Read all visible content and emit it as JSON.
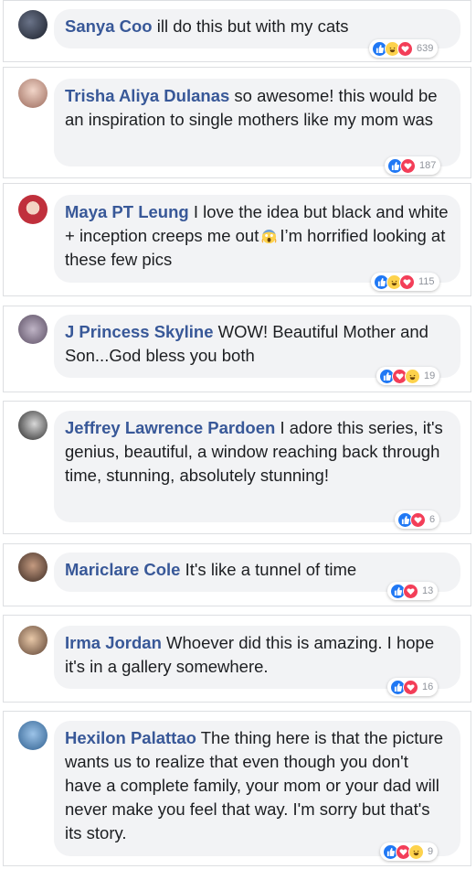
{
  "comments": [
    {
      "author": "Sanya Coo",
      "text": "ill do this but with my cats",
      "reactions": [
        "like",
        "haha",
        "love"
      ],
      "count": "639",
      "avatar_color": "#2a2f3a"
    },
    {
      "author": "Trisha Aliya Dulanas",
      "text": "so awesome! this would be an inspiration to single mothers like my mom was",
      "reactions": [
        "like",
        "love"
      ],
      "count": "187",
      "avatar_color": "#d8b7a8"
    },
    {
      "author": "Maya PT Leung",
      "text": "I love the idea but black and white + inception creeps me out",
      "text2": "I’m horrified looking at these few pics",
      "reactions": [
        "like",
        "haha",
        "love"
      ],
      "count": "115",
      "avatar_color": "#b33a45",
      "emoji": "screaming-face-icon"
    },
    {
      "author": "J Princess Skyline",
      "text": "WOW! Beautiful Mother and Son...God bless you both",
      "reactions": [
        "like",
        "love",
        "haha"
      ],
      "count": "19",
      "avatar_color": "#7a6a7f"
    },
    {
      "author": "Jeffrey Lawrence Pardoen",
      "text": "I adore this series, it's genius, beautiful, a window reaching back through time, stunning, absolutely stunning!",
      "reactions": [
        "like",
        "love"
      ],
      "count": "6",
      "avatar_color": "#3b3b3b"
    },
    {
      "author": "Mariclare Cole",
      "text": "It's like a tunnel of time",
      "reactions": [
        "like",
        "love"
      ],
      "count": "13",
      "avatar_color": "#6b4a3a"
    },
    {
      "author": "Irma Jordan",
      "text": "Whoever did this is amazing. I hope it's in a gallery somewhere.",
      "reactions": [
        "like",
        "love"
      ],
      "count": "16",
      "avatar_color": "#8a6a55"
    },
    {
      "author": "Hexilon Palattao",
      "text": "The thing here is that the picture wants us to realize that even though you don't have a complete family, your mom or your dad will never make you feel that way. I'm sorry but that's its story.",
      "reactions": [
        "like",
        "love",
        "haha"
      ],
      "count": "9",
      "avatar_color": "#4a7fb0"
    }
  ],
  "colors": {
    "author": "#385898",
    "like": "#2078f4",
    "love": "#f33e58",
    "haha": "#fdd24c"
  }
}
